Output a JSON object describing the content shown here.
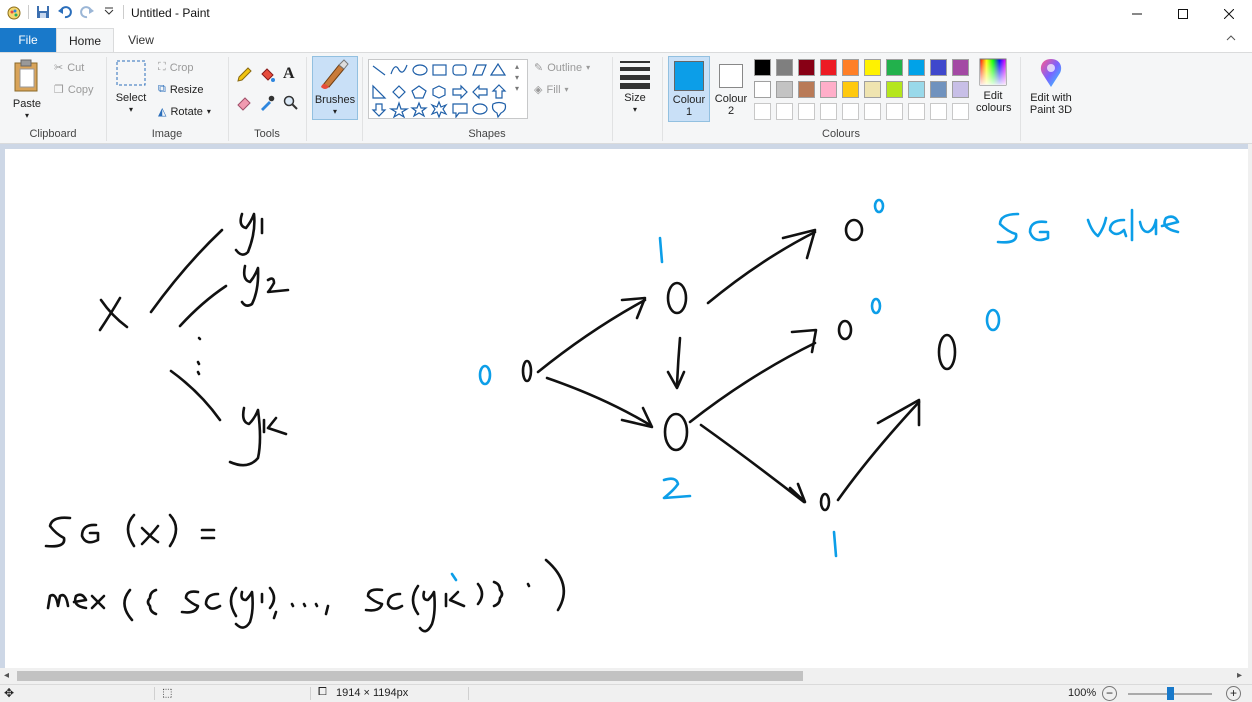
{
  "window": {
    "title": "Untitled - Paint"
  },
  "tabs": [
    {
      "label": "File"
    },
    {
      "label": "Home"
    },
    {
      "label": "View"
    }
  ],
  "ribbon": {
    "clipboard": {
      "group": "Clipboard",
      "paste": "Paste",
      "cut": "Cut",
      "copy": "Copy"
    },
    "image": {
      "group": "Image",
      "select": "Select",
      "crop": "Crop",
      "resize": "Resize",
      "rotate": "Rotate"
    },
    "tools": {
      "group": "Tools"
    },
    "brushes": {
      "label": "Brushes"
    },
    "shapes": {
      "group": "Shapes",
      "outline": "Outline",
      "fill": "Fill"
    },
    "size": {
      "label": "Size"
    },
    "colours": {
      "group": "Colours",
      "colour1": "Colour 1",
      "colour2": "Colour 2",
      "colour1_value": "#0c9ee8",
      "colour2_value": "#ffffff",
      "edit_colours": "Edit colours",
      "edit_3d": "Edit with Paint 3D",
      "palette_row1": [
        "#000000",
        "#7f7f7f",
        "#880015",
        "#ed1c24",
        "#ff7f27",
        "#fff200",
        "#22b14c",
        "#00a2e8",
        "#3f48cc",
        "#a349a4"
      ],
      "palette_row2": [
        "#ffffff",
        "#c3c3c3",
        "#b97a57",
        "#ffaec9",
        "#ffc90e",
        "#efe4b0",
        "#b5e61d",
        "#99d9ea",
        "#7092be",
        "#c8bfe7"
      ]
    }
  },
  "canvas_notes": {
    "sg_value": "SG value",
    "formula_line1": "SG(x) =",
    "formula_line2": "mex( { SG(y1), ..., SG(yk) } )",
    "labels": [
      "x",
      "y1",
      "y2",
      "yk",
      "0",
      "1",
      "2"
    ]
  },
  "status": {
    "dimensions": "1914 × 1194px",
    "zoom": "100%"
  }
}
